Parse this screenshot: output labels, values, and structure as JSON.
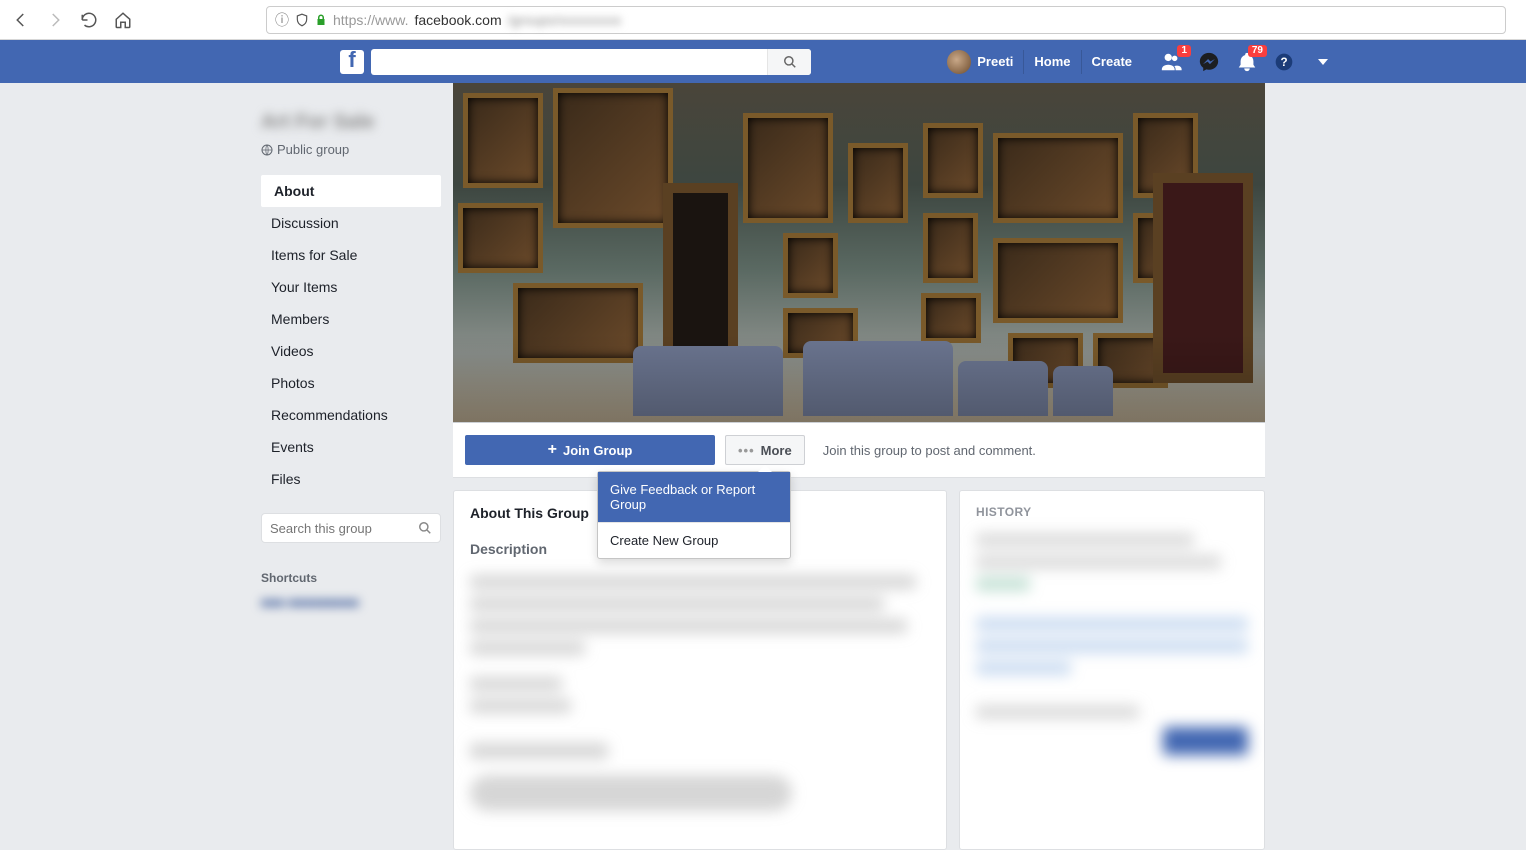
{
  "browser": {
    "url_prefix": "https://www.",
    "url_host": "facebook.com",
    "url_rest": "/groups/xxxxxxxxx"
  },
  "topnav": {
    "user": "Preeti",
    "home": "Home",
    "create": "Create",
    "friend_badge": "1",
    "notif_badge": "79"
  },
  "group": {
    "name": "Art For Sale",
    "privacy": "Public group"
  },
  "sidenav": {
    "items": [
      "About",
      "Discussion",
      "Items for Sale",
      "Your Items",
      "Members",
      "Videos",
      "Photos",
      "Recommendations",
      "Events",
      "Files"
    ],
    "search_placeholder": "Search this group",
    "shortcuts_heading": "Shortcuts",
    "shortcut_item": "■■■ ■■■■■■■■■"
  },
  "actions": {
    "join": "Join Group",
    "more": "More",
    "hint": "Join this group to post and comment."
  },
  "dropdown": {
    "item1": "Give Feedback or Report Group",
    "item2": "Create New Group"
  },
  "about": {
    "heading": "About This Group",
    "description_label": "Description"
  },
  "history": {
    "heading": "HISTORY"
  }
}
